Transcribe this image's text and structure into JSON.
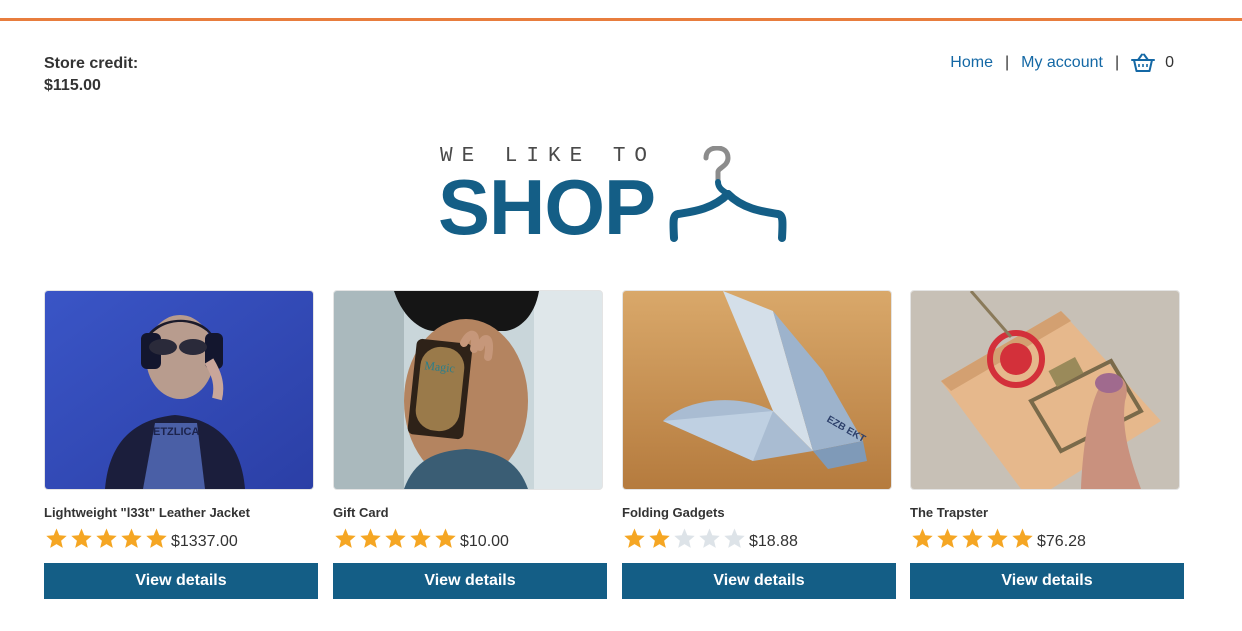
{
  "header": {
    "store_credit_label": "Store credit:",
    "store_credit_value": "$115.00",
    "nav": {
      "home": "Home",
      "separator": "|",
      "my_account": "My account",
      "cart_count": "0"
    }
  },
  "logo": {
    "tagline": "WE LIKE TO",
    "wordmark": "SHOP"
  },
  "colors": {
    "accent_orange": "#e87d3e",
    "brand_blue": "#145e86",
    "link_blue": "#1468a5",
    "star_gold": "#f5a623",
    "star_empty": "#dde3e8"
  },
  "products": [
    {
      "name": "Lightweight \"l33t\" Leather Jacket",
      "rating": 5,
      "max_rating": 5,
      "price": "$1337.00",
      "button": "View details",
      "image_icon": "woman-headphones-photo"
    },
    {
      "name": "Gift Card",
      "rating": 5,
      "max_rating": 5,
      "price": "$10.00",
      "button": "View details",
      "image_icon": "man-holding-card-photo"
    },
    {
      "name": "Folding Gadgets",
      "rating": 2,
      "max_rating": 5,
      "price": "$18.88",
      "button": "View details",
      "image_icon": "origami-bird-photo"
    },
    {
      "name": "The Trapster",
      "rating": 5,
      "max_rating": 5,
      "price": "$76.28",
      "button": "View details",
      "image_icon": "mousetrap-photo"
    }
  ]
}
